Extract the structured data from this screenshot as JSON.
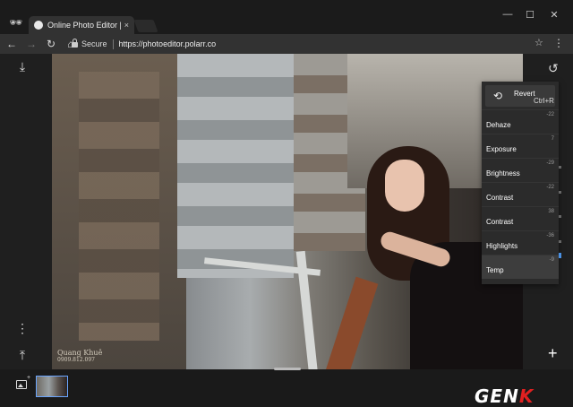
{
  "browser": {
    "tab_title": "Online Photo Editor | Pola",
    "tab_close": "×",
    "secure_label": "Secure",
    "url": "https://photoeditor.polarr.co",
    "window_controls": {
      "minimize": "—",
      "maximize": "☐",
      "close": "✕"
    }
  },
  "toolbar": {
    "back_icon": "←",
    "forward_icon": "→",
    "reload_icon": "↻",
    "home_icon": "⌂",
    "star_icon": "☆",
    "menu_icon": "⋮"
  },
  "left_rail": {
    "import_icon": "⤓",
    "more_icon": "⋮",
    "export_icon": "⤒"
  },
  "photo": {
    "watermark_line1": "Quang Khuê",
    "watermark_line2": "0909.812.097"
  },
  "panel": {
    "revert_label": "Revert",
    "revert_shortcut": "Ctrl+R",
    "adjustments": [
      {
        "name": "Dehaze",
        "value": "-22"
      },
      {
        "name": "Exposure",
        "value": "7"
      },
      {
        "name": "Brightness",
        "value": "-29"
      },
      {
        "name": "Contrast",
        "value": "-22"
      },
      {
        "name": "Contrast",
        "value": "38"
      },
      {
        "name": "Highlights",
        "value": "-36"
      },
      {
        "name": "Temp",
        "value": "-9"
      }
    ]
  },
  "right_rail": {
    "history_icon": "↺",
    "add_icon": "+"
  },
  "bottom": {
    "gallery_plus": "+",
    "logo_text": "GEN",
    "logo_k": "K"
  }
}
